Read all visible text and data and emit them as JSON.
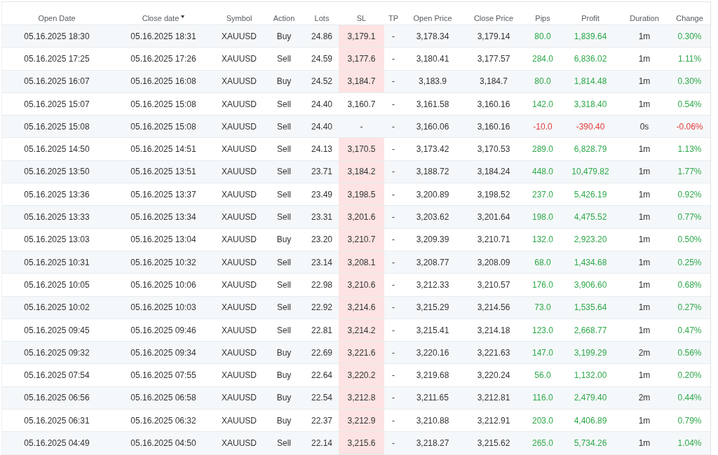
{
  "table": {
    "columns": [
      {
        "label": "Open Date",
        "sorted": false
      },
      {
        "label": "Close date",
        "sorted": true
      },
      {
        "label": "Symbol",
        "sorted": false
      },
      {
        "label": "Action",
        "sorted": false
      },
      {
        "label": "Lots",
        "sorted": false
      },
      {
        "label": "SL",
        "sorted": false
      },
      {
        "label": "TP",
        "sorted": false
      },
      {
        "label": "Open Price",
        "sorted": false
      },
      {
        "label": "Close Price",
        "sorted": false
      },
      {
        "label": "Pips",
        "sorted": false
      },
      {
        "label": "Profit",
        "sorted": false
      },
      {
        "label": "Duration",
        "sorted": false
      },
      {
        "label": "Change",
        "sorted": false
      }
    ],
    "rows": [
      {
        "open_date": "05.16.2025 18:30",
        "close_date": "05.16.2025 18:31",
        "symbol": "XAUUSD",
        "action": "Buy",
        "lots": "24.86",
        "sl": "3,179.1",
        "sl_highlighted": true,
        "tp": "-",
        "open_price": "3,178.34",
        "close_price": "3,179.14",
        "pips": "80.0",
        "profit": "1,839.64",
        "duration": "1m",
        "change": "0.30%",
        "negative": false
      },
      {
        "open_date": "05.16.2025 17:25",
        "close_date": "05.16.2025 17:26",
        "symbol": "XAUUSD",
        "action": "Sell",
        "lots": "24.59",
        "sl": "3,177.6",
        "sl_highlighted": true,
        "tp": "-",
        "open_price": "3,180.41",
        "close_price": "3,177.57",
        "pips": "284.0",
        "profit": "6,836.02",
        "duration": "1m",
        "change": "1.11%",
        "negative": false
      },
      {
        "open_date": "05.16.2025 16:07",
        "close_date": "05.16.2025 16:08",
        "symbol": "XAUUSD",
        "action": "Buy",
        "lots": "24.52",
        "sl": "3,184.7",
        "sl_highlighted": true,
        "tp": "-",
        "open_price": "3,183.9",
        "close_price": "3,184.7",
        "pips": "80.0",
        "profit": "1,814.48",
        "duration": "1m",
        "change": "0.30%",
        "negative": false
      },
      {
        "open_date": "05.16.2025 15:07",
        "close_date": "05.16.2025 15:08",
        "symbol": "XAUUSD",
        "action": "Sell",
        "lots": "24.40",
        "sl": "3,160.7",
        "sl_highlighted": false,
        "tp": "-",
        "open_price": "3,161.58",
        "close_price": "3,160.16",
        "pips": "142.0",
        "profit": "3,318.40",
        "duration": "1m",
        "change": "0.54%",
        "negative": false
      },
      {
        "open_date": "05.16.2025 15:08",
        "close_date": "05.16.2025 15:08",
        "symbol": "XAUUSD",
        "action": "Sell",
        "lots": "24.40",
        "sl": "-",
        "sl_highlighted": false,
        "tp": "-",
        "open_price": "3,160.06",
        "close_price": "3,160.16",
        "pips": "-10.0",
        "profit": "-390.40",
        "duration": "0s",
        "change": "-0.06%",
        "negative": true
      },
      {
        "open_date": "05.16.2025 14:50",
        "close_date": "05.16.2025 14:51",
        "symbol": "XAUUSD",
        "action": "Sell",
        "lots": "24.13",
        "sl": "3,170.5",
        "sl_highlighted": true,
        "tp": "-",
        "open_price": "3,173.42",
        "close_price": "3,170.53",
        "pips": "289.0",
        "profit": "6,828.79",
        "duration": "1m",
        "change": "1.13%",
        "negative": false
      },
      {
        "open_date": "05.16.2025 13:50",
        "close_date": "05.16.2025 13:51",
        "symbol": "XAUUSD",
        "action": "Sell",
        "lots": "23.71",
        "sl": "3,184.2",
        "sl_highlighted": true,
        "tp": "-",
        "open_price": "3,188.72",
        "close_price": "3,184.24",
        "pips": "448.0",
        "profit": "10,479.82",
        "duration": "1m",
        "change": "1.77%",
        "negative": false
      },
      {
        "open_date": "05.16.2025 13:36",
        "close_date": "05.16.2025 13:37",
        "symbol": "XAUUSD",
        "action": "Sell",
        "lots": "23.49",
        "sl": "3,198.5",
        "sl_highlighted": true,
        "tp": "-",
        "open_price": "3,200.89",
        "close_price": "3,198.52",
        "pips": "237.0",
        "profit": "5,426.19",
        "duration": "1m",
        "change": "0.92%",
        "negative": false
      },
      {
        "open_date": "05.16.2025 13:33",
        "close_date": "05.16.2025 13:34",
        "symbol": "XAUUSD",
        "action": "Sell",
        "lots": "23.31",
        "sl": "3,201.6",
        "sl_highlighted": true,
        "tp": "-",
        "open_price": "3,203.62",
        "close_price": "3,201.64",
        "pips": "198.0",
        "profit": "4,475.52",
        "duration": "1m",
        "change": "0.77%",
        "negative": false
      },
      {
        "open_date": "05.16.2025 13:03",
        "close_date": "05.16.2025 13:04",
        "symbol": "XAUUSD",
        "action": "Buy",
        "lots": "23.20",
        "sl": "3,210.7",
        "sl_highlighted": true,
        "tp": "-",
        "open_price": "3,209.39",
        "close_price": "3,210.71",
        "pips": "132.0",
        "profit": "2,923.20",
        "duration": "1m",
        "change": "0.50%",
        "negative": false
      },
      {
        "open_date": "05.16.2025 10:31",
        "close_date": "05.16.2025 10:32",
        "symbol": "XAUUSD",
        "action": "Sell",
        "lots": "23.14",
        "sl": "3,208.1",
        "sl_highlighted": true,
        "tp": "-",
        "open_price": "3,208.77",
        "close_price": "3,208.09",
        "pips": "68.0",
        "profit": "1,434.68",
        "duration": "1m",
        "change": "0.25%",
        "negative": false
      },
      {
        "open_date": "05.16.2025 10:05",
        "close_date": "05.16.2025 10:06",
        "symbol": "XAUUSD",
        "action": "Sell",
        "lots": "22.98",
        "sl": "3,210.6",
        "sl_highlighted": true,
        "tp": "-",
        "open_price": "3,212.33",
        "close_price": "3,210.57",
        "pips": "176.0",
        "profit": "3,906.60",
        "duration": "1m",
        "change": "0.68%",
        "negative": false
      },
      {
        "open_date": "05.16.2025 10:02",
        "close_date": "05.16.2025 10:03",
        "symbol": "XAUUSD",
        "action": "Sell",
        "lots": "22.92",
        "sl": "3,214.6",
        "sl_highlighted": true,
        "tp": "-",
        "open_price": "3,215.29",
        "close_price": "3,214.56",
        "pips": "73.0",
        "profit": "1,535.64",
        "duration": "1m",
        "change": "0.27%",
        "negative": false
      },
      {
        "open_date": "05.16.2025 09:45",
        "close_date": "05.16.2025 09:46",
        "symbol": "XAUUSD",
        "action": "Sell",
        "lots": "22.81",
        "sl": "3,214.2",
        "sl_highlighted": true,
        "tp": "-",
        "open_price": "3,215.41",
        "close_price": "3,214.18",
        "pips": "123.0",
        "profit": "2,668.77",
        "duration": "1m",
        "change": "0.47%",
        "negative": false
      },
      {
        "open_date": "05.16.2025 09:32",
        "close_date": "05.16.2025 09:34",
        "symbol": "XAUUSD",
        "action": "Buy",
        "lots": "22.69",
        "sl": "3,221.6",
        "sl_highlighted": true,
        "tp": "-",
        "open_price": "3,220.16",
        "close_price": "3,221.63",
        "pips": "147.0",
        "profit": "3,199.29",
        "duration": "2m",
        "change": "0.56%",
        "negative": false
      },
      {
        "open_date": "05.16.2025 07:54",
        "close_date": "05.16.2025 07:55",
        "symbol": "XAUUSD",
        "action": "Buy",
        "lots": "22.64",
        "sl": "3,220.2",
        "sl_highlighted": true,
        "tp": "-",
        "open_price": "3,219.68",
        "close_price": "3,220.24",
        "pips": "56.0",
        "profit": "1,132.00",
        "duration": "1m",
        "change": "0.20%",
        "negative": false
      },
      {
        "open_date": "05.16.2025 06:56",
        "close_date": "05.16.2025 06:58",
        "symbol": "XAUUSD",
        "action": "Buy",
        "lots": "22.54",
        "sl": "3,212.8",
        "sl_highlighted": true,
        "tp": "-",
        "open_price": "3,211.65",
        "close_price": "3,212.81",
        "pips": "116.0",
        "profit": "2,479.40",
        "duration": "2m",
        "change": "0.44%",
        "negative": false
      },
      {
        "open_date": "05.16.2025 06:31",
        "close_date": "05.16.2025 06:32",
        "symbol": "XAUUSD",
        "action": "Buy",
        "lots": "22.37",
        "sl": "3,212.9",
        "sl_highlighted": true,
        "tp": "-",
        "open_price": "3,210.88",
        "close_price": "3,212.91",
        "pips": "203.0",
        "profit": "4,406.89",
        "duration": "1m",
        "change": "0.79%",
        "negative": false
      },
      {
        "open_date": "05.16.2025 04:49",
        "close_date": "05.16.2025 04:50",
        "symbol": "XAUUSD",
        "action": "Sell",
        "lots": "22.14",
        "sl": "3,215.6",
        "sl_highlighted": true,
        "tp": "-",
        "open_price": "3,218.27",
        "close_price": "3,215.62",
        "pips": "265.0",
        "profit": "5,734.26",
        "duration": "1m",
        "change": "1.04%",
        "negative": false
      }
    ]
  }
}
